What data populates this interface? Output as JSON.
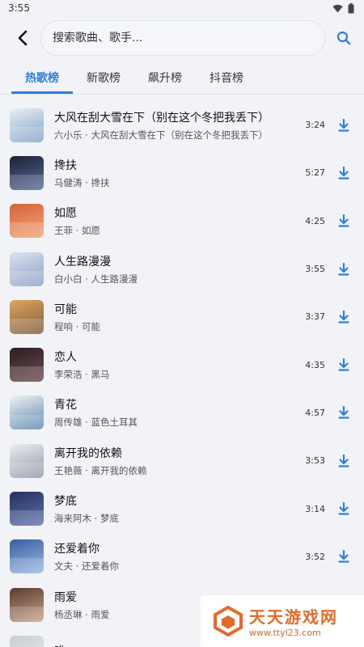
{
  "status": {
    "time": "3:55"
  },
  "header": {
    "back_icon": "chevron-left-icon",
    "search_placeholder": "搜索歌曲、歌手...",
    "search_icon": "search-icon"
  },
  "tabs": [
    {
      "label": "热歌榜",
      "active": true
    },
    {
      "label": "新歌榜",
      "active": false
    },
    {
      "label": "飙升榜",
      "active": false
    },
    {
      "label": "抖音榜",
      "active": false
    }
  ],
  "songs": [
    {
      "title": "大风在刮大雪在下（别在这个冬把我丢下）",
      "artist_album": "六小乐 · 大风在刮大雪在下（别在这个冬把我丢下）",
      "duration": "3:24",
      "cover": [
        "#e8eef6",
        "#7fa3c9"
      ]
    },
    {
      "title": "搀扶",
      "artist_album": "马健涛 · 搀扶",
      "duration": "5:27",
      "cover": [
        "#1c1f33",
        "#5a6b9c"
      ]
    },
    {
      "title": "如愿",
      "artist_album": "王菲 · 如愿",
      "duration": "4:25",
      "cover": [
        "#d9603a",
        "#f2a679"
      ]
    },
    {
      "title": "人生路漫漫",
      "artist_album": "白小白 · 人生路漫漫",
      "duration": "3:55",
      "cover": [
        "#dbe3f0",
        "#8e9fc4"
      ]
    },
    {
      "title": "可能",
      "artist_album": "程响 · 可能",
      "duration": "3:37",
      "cover": [
        "#e0a55f",
        "#7c5a3a"
      ]
    },
    {
      "title": "恋人",
      "artist_album": "李荣浩 · 黑马",
      "duration": "4:35",
      "cover": [
        "#2a1e22",
        "#6e4a4e"
      ]
    },
    {
      "title": "青花",
      "artist_album": "周传雄 · 蓝色土耳其",
      "duration": "4:57",
      "cover": [
        "#f0f2f4",
        "#5b86b0"
      ]
    },
    {
      "title": "离开我的依赖",
      "artist_album": "王艳薇 · 离开我的依赖",
      "duration": "3:53",
      "cover": [
        "#eceef2",
        "#8f96a6"
      ]
    },
    {
      "title": "梦底",
      "artist_album": "海来阿木 · 梦底",
      "duration": "3:14",
      "cover": [
        "#24305c",
        "#5f73b1"
      ]
    },
    {
      "title": "还爱着你",
      "artist_album": "文夫 · 还爱着你",
      "duration": "3:52",
      "cover": [
        "#3a5fa0",
        "#9bb9e3"
      ]
    },
    {
      "title": "雨爱",
      "artist_album": "杨丞琳 · 雨爱",
      "duration": "",
      "cover": [
        "#5a3b2e",
        "#c9a48a"
      ]
    },
    {
      "title": "唯一",
      "artist_album": "",
      "duration": "",
      "cover": [
        "#c9ccd2",
        "#eef0f3"
      ]
    }
  ],
  "watermark": {
    "title": "天天游戏网",
    "url": "www.ttyl23.com"
  },
  "colors": {
    "accent": "#2f7de1",
    "background": "#f2f3f7",
    "watermark": "#e56a28"
  }
}
